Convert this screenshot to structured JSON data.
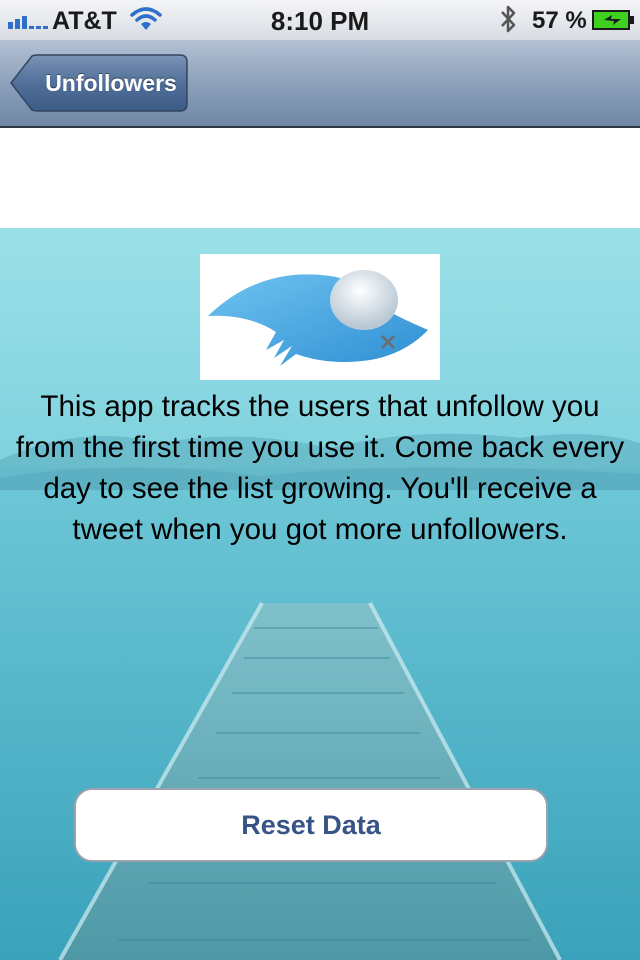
{
  "status_bar": {
    "carrier": "AT&T",
    "time": "8:10 PM",
    "battery_percent": "57 %",
    "signal_icon": "signal-bars-icon",
    "wifi_icon": "wifi-icon",
    "bluetooth_icon": "bluetooth-icon",
    "battery_icon": "battery-charging-icon"
  },
  "nav": {
    "back_label": "Unfollowers"
  },
  "main": {
    "logo_icon": "sad-bird-logo",
    "description": "This app tracks the users that unfollow you from the first time you use it. Come back every day to see the list growing. You'll receive a tweet when you got more unfollowers.",
    "reset_label": "Reset Data"
  },
  "colors": {
    "nav_tint": "#6f87a6",
    "button_text": "#385487",
    "background_water": "#5fbdd0"
  }
}
